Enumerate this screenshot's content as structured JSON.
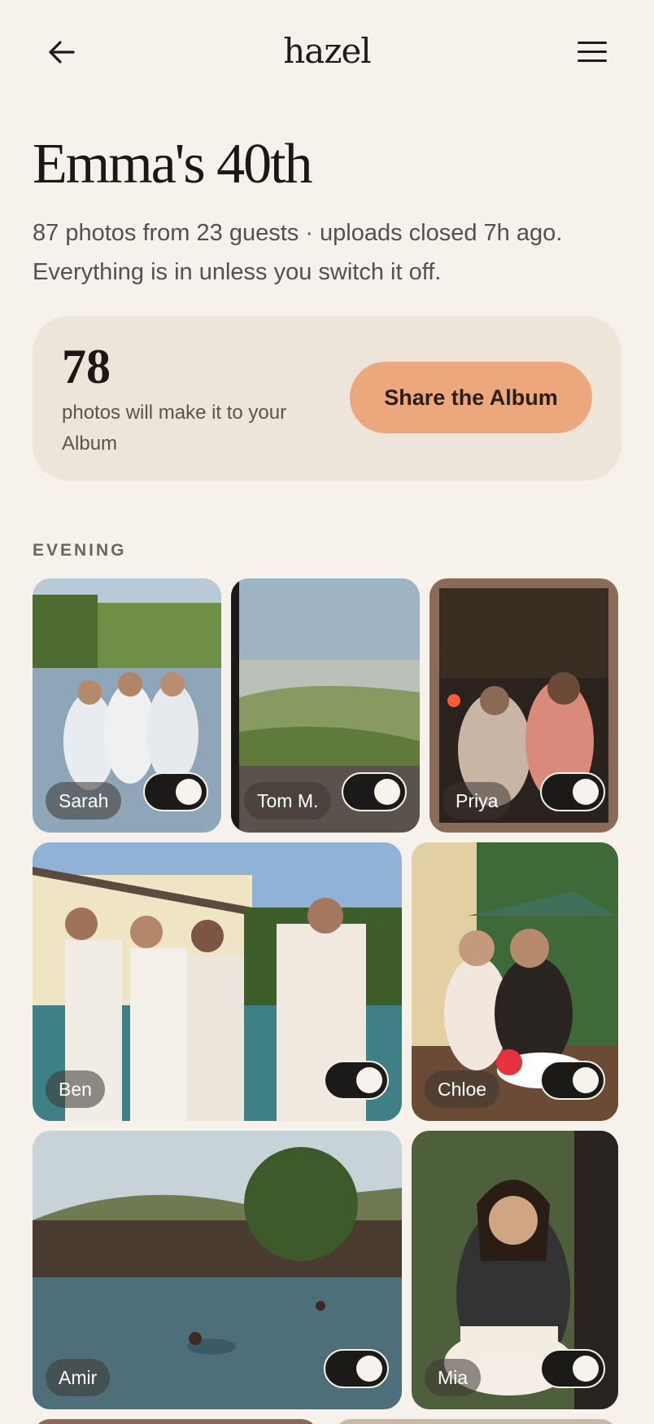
{
  "header": {
    "logo": "hazel",
    "back_icon": "arrow-left-icon",
    "menu_icon": "hamburger-menu-icon"
  },
  "page": {
    "title": "Emma's 40th",
    "subtitle": "87 photos from 23 guests · uploads closed 7h ago. Everything is in unless you switch it off."
  },
  "share_card": {
    "count": "78",
    "count_label": "photos will make it to your Album",
    "button_label": "Share the Album"
  },
  "section": {
    "label": "EVENING"
  },
  "photos": [
    {
      "guest": "Sarah",
      "included": true
    },
    {
      "guest": "Tom M.",
      "included": true
    },
    {
      "guest": "Priya",
      "included": true
    },
    {
      "guest": "Ben",
      "included": true
    },
    {
      "guest": "Chloe",
      "included": true
    },
    {
      "guest": "Amir",
      "included": true
    },
    {
      "guest": "Mia",
      "included": true
    }
  ],
  "colors": {
    "background": "#f6f1eb",
    "accent": "#eda77c",
    "card": "#ede5da",
    "toggle_on": "#1c1a18"
  }
}
